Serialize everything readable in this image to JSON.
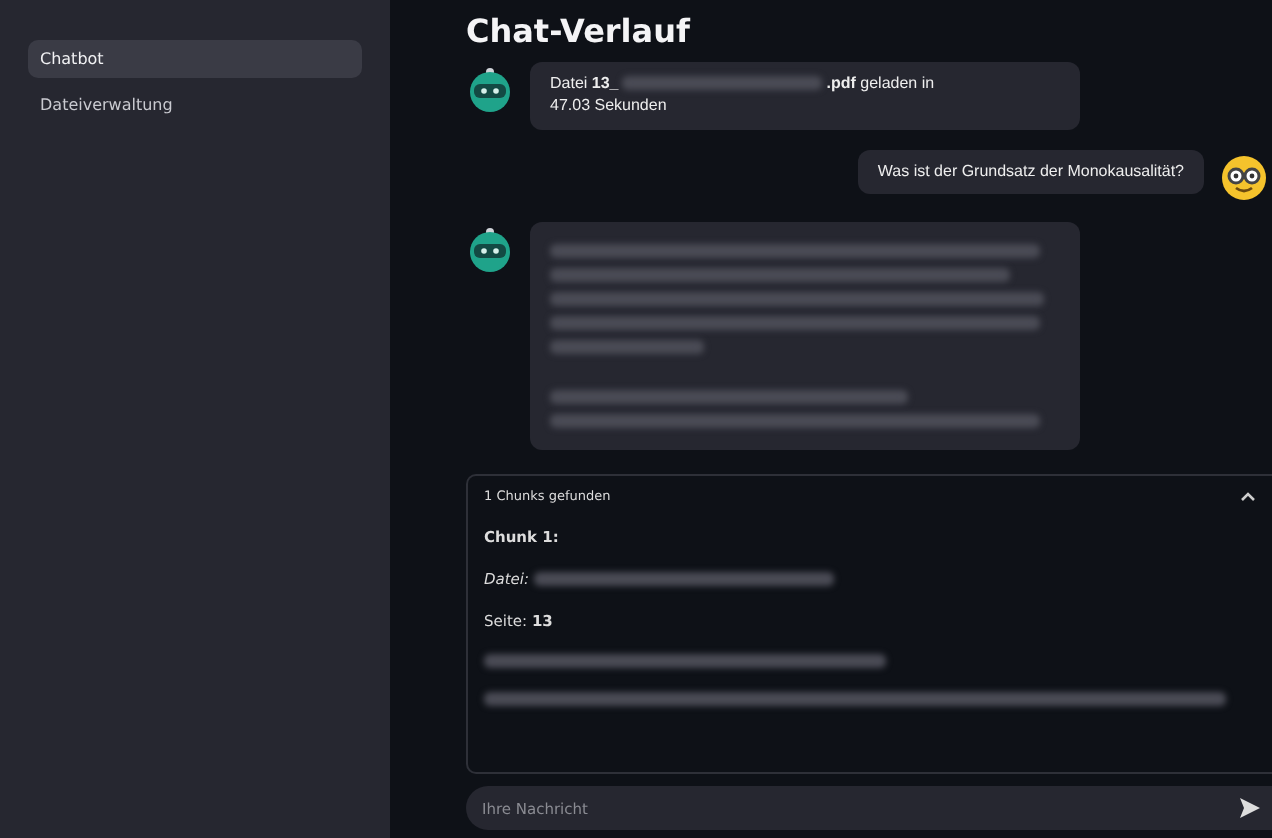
{
  "sidebar": {
    "items": [
      {
        "label": "Chatbot",
        "selected": true
      },
      {
        "label": "Dateiverwaltung",
        "selected": false
      }
    ]
  },
  "title": "Chat-Verlauf",
  "messages": [
    {
      "kind": "bot",
      "parts": [
        {
          "kind": "text",
          "text": "Datei **13_**"
        },
        {
          "kind": "redacted"
        },
        {
          "kind": "text",
          "text": "**.pdf** geladen in"
        },
        {
          "kind": "line",
          "text": "47.03 Sekunden"
        }
      ]
    },
    {
      "kind": "user",
      "parts": [
        {
          "kind": "text",
          "text": "Was ist der Grundsatz der Monokausalität?"
        }
      ]
    },
    {
      "kind": "bot",
      "parts": [
        {
          "kind": "redacted"
        },
        {
          "kind": "redacted"
        },
        {
          "kind": "redacted"
        },
        {
          "kind": "redacted"
        },
        {
          "kind": "redacted"
        },
        {
          "kind": "gap"
        },
        {
          "kind": "redacted"
        },
        {
          "kind": "redacted"
        }
      ]
    }
  ],
  "expander": {
    "label": "1 Chunks gefunden",
    "expanded": true,
    "lines": [
      {
        "kind": "heading",
        "text": "Chunk 1:"
      },
      {
        "kind": "field",
        "label": "Datei:"
      },
      {
        "kind": "text",
        "text": "Seite: **13**"
      },
      {
        "kind": "redacted"
      },
      {
        "kind": "redacted"
      }
    ]
  },
  "input": {
    "placeholder": "Ihre Nachricht"
  }
}
